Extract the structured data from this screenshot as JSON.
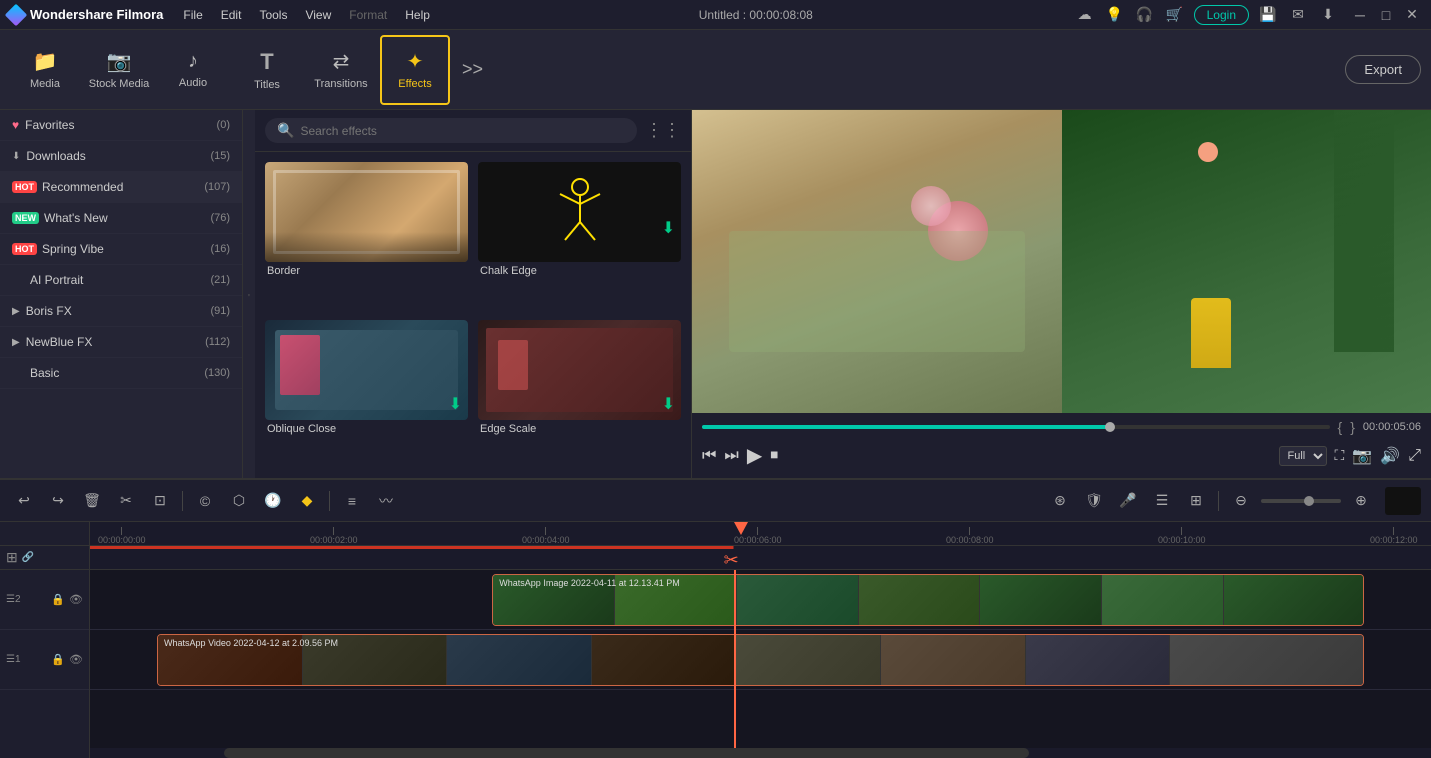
{
  "app": {
    "name": "Wondershare Filmora",
    "title": "Untitled : 00:00:08:08"
  },
  "menu": {
    "items": [
      "File",
      "Edit",
      "Tools",
      "View",
      "Format",
      "Help"
    ]
  },
  "toolbar": {
    "items": [
      {
        "id": "media",
        "label": "Media",
        "icon": "📁"
      },
      {
        "id": "stock",
        "label": "Stock Media",
        "icon": "📷"
      },
      {
        "id": "audio",
        "label": "Audio",
        "icon": "🎵"
      },
      {
        "id": "titles",
        "label": "Titles",
        "icon": "T"
      },
      {
        "id": "transitions",
        "label": "Transitions",
        "icon": "⟷"
      },
      {
        "id": "effects",
        "label": "Effects",
        "icon": "✦"
      }
    ],
    "export_label": "Export"
  },
  "left_panel": {
    "items": [
      {
        "id": "favorites",
        "label": "Favorites",
        "count": "(0)",
        "badge": null
      },
      {
        "id": "downloads",
        "label": "Downloads",
        "count": "(15)",
        "badge": null
      },
      {
        "id": "recommended",
        "label": "Recommended",
        "count": "(107)",
        "badge": "HOT"
      },
      {
        "id": "whats_new",
        "label": "What's New",
        "count": "(76)",
        "badge": "NEW"
      },
      {
        "id": "spring_vibe",
        "label": "Spring Vibe",
        "count": "(16)",
        "badge": "HOT"
      },
      {
        "id": "ai_portrait",
        "label": "AI Portrait",
        "count": "(21)",
        "badge": null
      },
      {
        "id": "boris_fx",
        "label": "Boris FX",
        "count": "(91)",
        "badge": null
      },
      {
        "id": "newblue_fx",
        "label": "NewBlue FX",
        "count": "(112)",
        "badge": null
      },
      {
        "id": "basic",
        "label": "Basic",
        "count": "(130)",
        "badge": null
      }
    ]
  },
  "effects": {
    "search_placeholder": "Search effects",
    "items": [
      {
        "id": "border",
        "label": "Border",
        "has_download": false
      },
      {
        "id": "chalk_edge",
        "label": "Chalk Edge",
        "has_download": true
      },
      {
        "id": "oblique_close",
        "label": "Oblique Close",
        "has_download": true
      },
      {
        "id": "edge_scale",
        "label": "Edge Scale",
        "has_download": true
      }
    ]
  },
  "preview": {
    "time_current": "00:00:05:06",
    "quality": "Full"
  },
  "timeline": {
    "tracks": [
      {
        "id": "track2",
        "num": "2",
        "clip_label": "WhatsApp Image 2022-04-11 at 12.13.41 PM"
      },
      {
        "id": "track1",
        "num": "1",
        "clip_label": "WhatsApp Video 2022-04-12 at 2.09.56 PM"
      }
    ],
    "time_markers": [
      "00:00:00:00",
      "00:00:02:00",
      "00:00:04:00",
      "00:00:06:00",
      "00:00:08:00",
      "00:00:10:00",
      "00:00:12:00"
    ]
  }
}
